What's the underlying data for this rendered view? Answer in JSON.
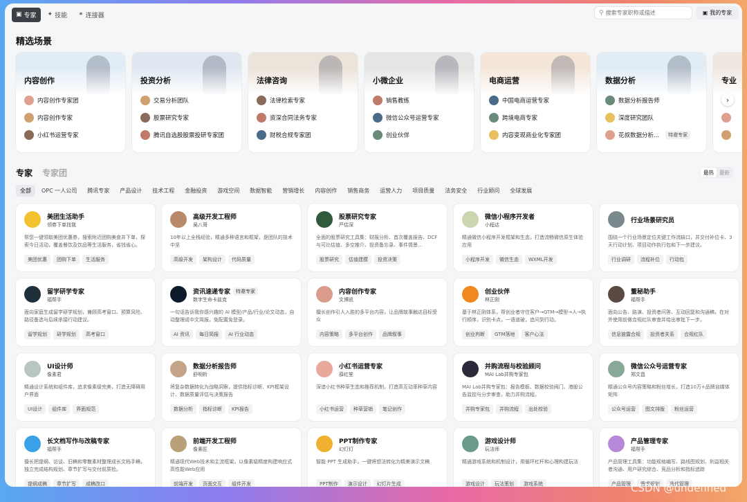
{
  "nav": {
    "tabs": [
      {
        "label": "专家",
        "icon": "badge-icon"
      },
      {
        "label": "技能",
        "icon": "skill-icon"
      },
      {
        "label": "连接器",
        "icon": "link-icon"
      }
    ],
    "search_placeholder": "搜索专家职称或描述",
    "mine_label": "我的专家"
  },
  "scenarios": {
    "title": "精选场景",
    "cards": [
      {
        "title": "内容创作",
        "bg": "#e2ecf6",
        "items": [
          {
            "label": "内容创作专家团",
            "badge": ""
          },
          {
            "label": "内容创作专家",
            "badge": ""
          },
          {
            "label": "小红书运营专家",
            "badge": ""
          }
        ]
      },
      {
        "title": "投资分析",
        "bg": "#dfe8f1",
        "items": [
          {
            "label": "交易分析团队",
            "badge": ""
          },
          {
            "label": "股票研究专家",
            "badge": ""
          },
          {
            "label": "腾讯自选股股票投研专家团",
            "badge": ""
          }
        ]
      },
      {
        "title": "法律咨询",
        "bg": "#ece3da",
        "items": [
          {
            "label": "法律检索专家",
            "badge": ""
          },
          {
            "label": "资深合同法务专家",
            "badge": ""
          },
          {
            "label": "财税合规专家团",
            "badge": ""
          }
        ]
      },
      {
        "title": "小微企业",
        "bg": "#e7e5e4",
        "items": [
          {
            "label": "销售教练",
            "badge": ""
          },
          {
            "label": "微信公众号运营专家",
            "badge": ""
          },
          {
            "label": "创业伙伴",
            "badge": ""
          }
        ]
      },
      {
        "title": "电商运营",
        "bg": "#f4e6d8",
        "items": [
          {
            "label": "中国电商运营专家",
            "badge": ""
          },
          {
            "label": "跨境电商专家",
            "badge": ""
          },
          {
            "label": "内容变现商业化专家团",
            "badge": ""
          }
        ]
      },
      {
        "title": "数据分析",
        "bg": "#e1ecf5",
        "items": [
          {
            "label": "数据分析报告师",
            "badge": ""
          },
          {
            "label": "深度研究团队",
            "badge": ""
          },
          {
            "label": "花叔数据分析...",
            "badge": "特邀专家"
          }
        ]
      },
      {
        "title": "专业",
        "bg": "#efe7e2",
        "items": [
          {
            "label": "",
            "badge": ""
          },
          {
            "label": "",
            "badge": ""
          },
          {
            "label": "",
            "badge": ""
          }
        ]
      }
    ]
  },
  "experts_tabs": [
    "专家",
    "专家团"
  ],
  "sort": [
    "最热",
    "最新"
  ],
  "categories": [
    "全部",
    "OPC 一人公司",
    "腾讯专家",
    "产品设计",
    "技术工程",
    "金融投资",
    "游戏空间",
    "数据智能",
    "营销增长",
    "内容创作",
    "销售商务",
    "运营人力",
    "项目质量",
    "法务安全",
    "行业顾问",
    "全球发展"
  ],
  "experts": [
    {
      "name": "美团生活助手",
      "sub": "领券下单找我",
      "badge": "",
      "desc": "帮您一键领取美团优惠券，搜索附近团购美食并下单，探索今日活动，覆盖餐饮及饮品等生活服务，省钱省心。",
      "tags": [
        "美团优惠",
        "团购下单",
        "生活服务"
      ],
      "color": "#f2c230"
    },
    {
      "name": "高级开发工程师",
      "sub": "吴八哥",
      "badge": "",
      "desc": "10年以上全栈经验，精通多种语言和框架，是团队的技术中坚",
      "tags": [
        "高级开发",
        "架构设计",
        "代码质量"
      ],
      "color": "#b98a6a"
    },
    {
      "name": "股票研究专家",
      "sub": "严估深",
      "badge": "",
      "desc": "全面的股票研究工具集：财报分析、首次覆盖报告、DCF与可比估值、多空推介、投资备忘录、事件情景…",
      "tags": [
        "股票研究",
        "估值建模",
        "投资决策"
      ],
      "color": "#2f5a3c"
    },
    {
      "name": "微信小程序开发者",
      "sub": "小程达",
      "badge": "",
      "desc": "精通微信小程序开发框架和生态，打造流畅微信原生体验应用",
      "tags": [
        "小程序开发",
        "微信生态",
        "WXML开发"
      ],
      "color": "#c9d6b0"
    },
    {
      "name": "行业场景研究员",
      "sub": "",
      "badge": "",
      "desc": "围绕一个行业场景定位关键工作流缺口，并交付补位卡、3天行动计划、项目动作执行包和下一步建议。",
      "tags": [
        "行业调研",
        "流程补位",
        "行动包"
      ],
      "color": "#7a8a8c"
    },
    {
      "name": "留学研学专家",
      "sub": "福帮手",
      "badge": "",
      "desc": "面向家庭生成留学研学规划，兼顾高考窗口、预算风险、路径备选与后续承接行动建议。",
      "tags": [
        "留学规划",
        "研学规划",
        "高考窗口"
      ],
      "color": "#20303a"
    },
    {
      "name": "资讯速递专家",
      "sub": "数字生命卡兹克",
      "badge": "特邀专家",
      "desc": "一句话告诉我你感兴趣的 AI 模型/产品/行业/论文动态，自动整理成中文简报，免配置免登录。",
      "tags": [
        "AI 资讯",
        "每日简报",
        "AI 行业动态"
      ],
      "color": "#0c1a2a"
    },
    {
      "name": "内容创作专家",
      "sub": "文博凯",
      "badge": "",
      "desc": "擅长创作引人入胜的多平台内容，让品牌故事触达目标受众",
      "tags": [
        "内容策略",
        "多平台创作",
        "品牌叙事"
      ],
      "color": "#d99c8a"
    },
    {
      "name": "创业伙伴",
      "sub": "林正刚",
      "badge": "",
      "desc": "基于林正刚体系，帮创业者守住客户→GTM→模型→人→执行顺序，识别卡点，一语道破，追问到行动。",
      "tags": [
        "创业判断",
        "GTM落地",
        "客户心法"
      ],
      "color": "#f08a20"
    },
    {
      "name": "董秘助手",
      "sub": "福帮手",
      "badge": "",
      "desc": "面向公告、路演、投资者问答、互动回复和沟通稿，在对外使用前做合规红队审查并给出审批下一步。",
      "tags": [
        "信息披露合规",
        "投资者关系",
        "合规红队"
      ],
      "color": "#5a4a42"
    },
    {
      "name": "UI设计师",
      "sub": "像素君",
      "badge": "",
      "desc": "精通设计系统和组件库，追求像素级完美，打造无障碍用户界面",
      "tags": [
        "UI设计",
        "组件库",
        "界面规范"
      ],
      "color": "#b8c6c2"
    },
    {
      "name": "数据分析报告师",
      "sub": "舒明析",
      "badge": "",
      "desc": "将复杂数据转化为战略洞察，提供指标诊断、KPI框架设计、数据质量评估与决策报告",
      "tags": [
        "数据分析",
        "指标诊断",
        "KPI报告"
      ],
      "color": "#c4a488"
    },
    {
      "name": "小红书运营专家",
      "sub": "薛红笙",
      "badge": "",
      "desc": "深谙小红书种草生态和推荐机制，打造高互动率种草内容",
      "tags": [
        "小红书运营",
        "种草营销",
        "笔记创作"
      ],
      "color": "#e8a89a"
    },
    {
      "name": "并购流程与校验顾问",
      "sub": "MAI Lab并购专家包",
      "badge": "",
      "desc": "MAI Lab并购专家包：报告模板、数据校验阀门、港股公告监控与分步审查，助力并购流程。",
      "tags": [
        "并购专家包",
        "并购流程",
        "出处校验"
      ],
      "color": "#2a2a3a"
    },
    {
      "name": "微信公众号运营专家",
      "sub": "郑文昌",
      "badge": "",
      "desc": "精通公众号内容策略和粉丝增长，打造10万+品牌自媒体矩阵",
      "tags": [
        "公众号运营",
        "图文排版",
        "粉丝运营"
      ],
      "color": "#8aa898"
    },
    {
      "name": "长文档写作与改稿专家",
      "sub": "福帮手",
      "badge": "",
      "desc": "擅长把提纲、访谈、旧稿和零散素材整理成长文档手稿，独立完成结构规划、章节扩写与交付前质检。",
      "tags": [
        "提纲成稿",
        "章节扩写",
        "成稿改口"
      ],
      "color": "#3aa0e8"
    },
    {
      "name": "前端开发工程师",
      "sub": "像素匠",
      "badge": "",
      "desc": "精通现代Web技术和主流框架，以像素级精度构建响应式高性能Web应用",
      "tags": [
        "前端开发",
        "页面交互",
        "组件开发"
      ],
      "color": "#b8a078"
    },
    {
      "name": "PPT制作专家",
      "sub": "幻灯灯",
      "badge": "",
      "desc": "智能 PPT 生成助手，一键将想法转化为精美演示文稿",
      "tags": [
        "PPT制作",
        "演示设计",
        "幻灯片生成"
      ],
      "color": "#f0b030"
    },
    {
      "name": "游戏设计师",
      "sub": "玩法师",
      "badge": "",
      "desc": "精通游戏系统和机制设计，用循环杠杆和心理构建玩法",
      "tags": [
        "游戏设计",
        "玩法策划",
        "游戏系统"
      ],
      "color": "#6a9a8a"
    },
    {
      "name": "产品管理专家",
      "sub": "福帮手",
      "badge": "",
      "desc": "产品管理工具集：功能规格编写、路线图规划、利益相关者沟通、用户研究综合、竞品分析和指标追踪",
      "tags": [
        "产品管理",
        "需求规划",
        "迭代管理"
      ],
      "color": "#b888d8"
    }
  ],
  "watermark": "CSDN @undefined"
}
